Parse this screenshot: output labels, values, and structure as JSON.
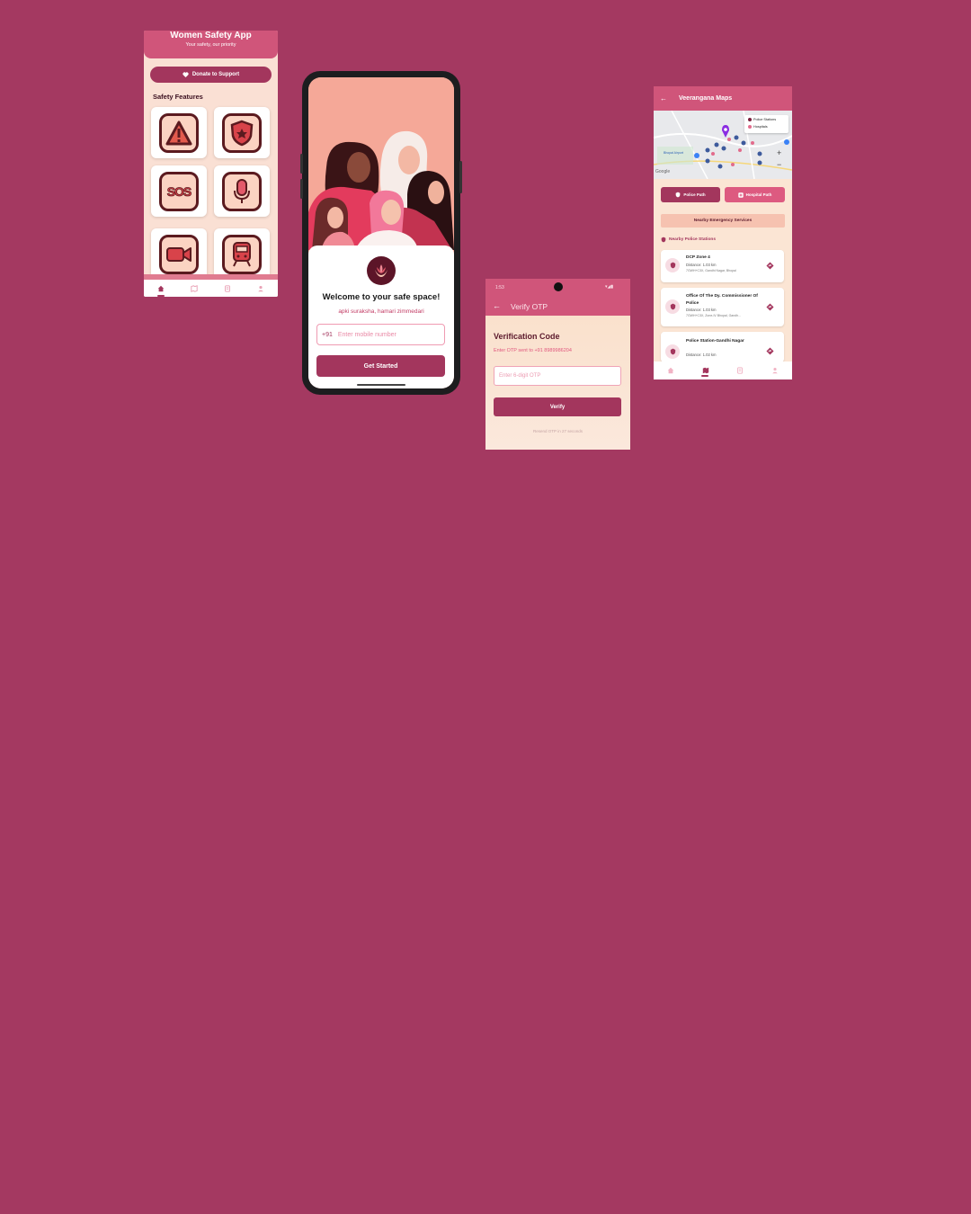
{
  "home": {
    "title": "Women Safety App",
    "subtitle": "Your safety, our priority",
    "donate_label": "Donate to Support",
    "section_title": "Safety Features",
    "features": [
      "warning-icon",
      "police-badge-icon",
      "SOS",
      "microphone-icon",
      "video-camera-icon",
      "train-icon"
    ],
    "nav": [
      "home-icon",
      "map-icon",
      "book-icon",
      "profile-icon"
    ]
  },
  "welcome": {
    "heading": "Welcome to your safe space!",
    "tagline": "apki suraksha, hamari zimmedari",
    "country_code": "+91",
    "phone_placeholder": "Enter mobile number",
    "button": "Get Started"
  },
  "otp": {
    "status_time": "1:53",
    "title": "Verify OTP",
    "heading": "Verification Code",
    "sent_to": "Enter OTP sent to +91 8989986204",
    "placeholder": "Enter 6-digit OTP",
    "button": "Verify",
    "resend": "Resend OTP in 27 seconds"
  },
  "maps": {
    "title": "Veerangana Maps",
    "legend": [
      "Police Stations",
      "Hospitals"
    ],
    "map_labels": [
      "Bhopal Airport",
      "Google"
    ],
    "police_path": "Police Path",
    "hospital_path": "Hospital Path",
    "nearby_title": "Nearby Emergency Services",
    "police_section": "Nearby Police Stations",
    "stations": [
      {
        "name": "DCP Zone 4",
        "distance": "Distance: 1.03 km",
        "address": "7GWH+C3X, Gandhi Nagar, Bhopal"
      },
      {
        "name": "Office Of The Dy. Commissioner Of Police",
        "distance": "Distance: 1.03 km",
        "address": "7GWH+C3X, Zone-IV Bhopal, Gandh..."
      },
      {
        "name": "Police Station-Gandhi Nagar",
        "distance": "Distance: 1.02 km",
        "address": ""
      }
    ]
  },
  "colors": {
    "background": "#a43961",
    "primary": "#a3365d",
    "header_pink": "#d0557a",
    "cream": "#fae0d4"
  }
}
